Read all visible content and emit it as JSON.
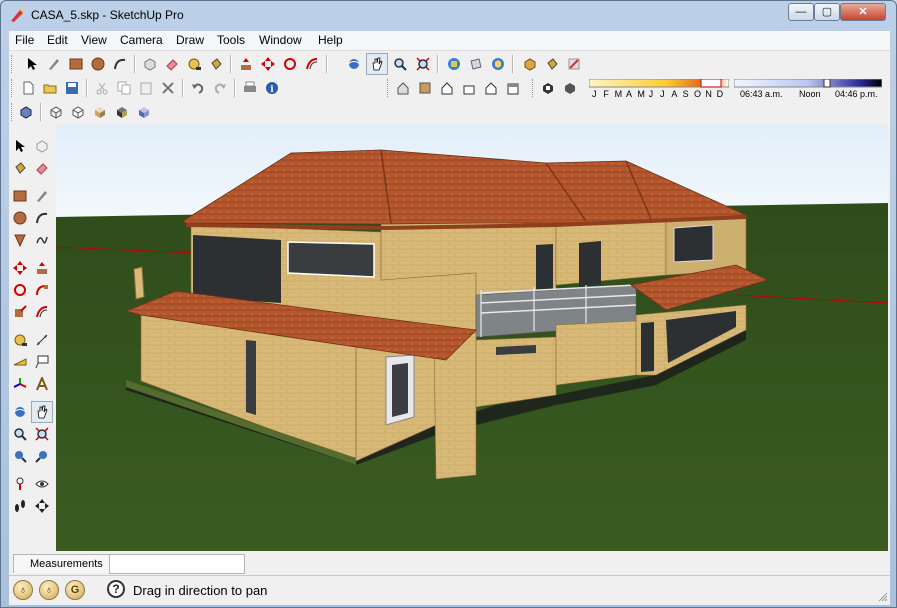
{
  "window": {
    "title": "CASA_5.skp - SketchUp Pro"
  },
  "menu": [
    "File",
    "Edit",
    "View",
    "Camera",
    "Draw",
    "Tools",
    "Window",
    "Help"
  ],
  "shadow": {
    "months": [
      "J",
      "F",
      "M",
      "A",
      "M",
      "J",
      "J",
      "A",
      "S",
      "O",
      "N",
      "D"
    ],
    "time_start": "06:43 a.m.",
    "time_noon": "Noon",
    "time_end": "04:46 p.m."
  },
  "measurements": {
    "label": "Measurements",
    "value": ""
  },
  "status": {
    "text": "Drag in direction to pan"
  },
  "colors": {
    "sky": "#e9f3fb",
    "ground": "#35531f",
    "roof": "#b4572e",
    "wall": "#d8b978",
    "axis_red": "#c00000"
  }
}
